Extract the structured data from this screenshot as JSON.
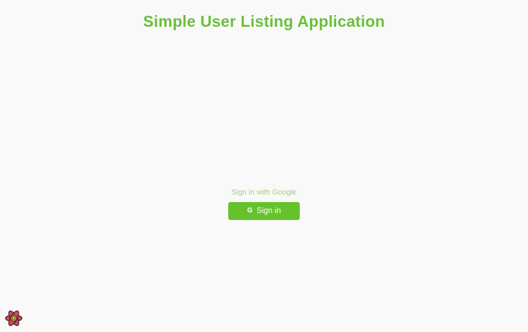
{
  "app": {
    "title": "Simple User Listing Application"
  },
  "signin": {
    "caption": "Sign in with Google",
    "button_label": "Sign in",
    "button_icon": "google-g-icon",
    "button_icon_glyph": "G"
  },
  "devtools": {
    "icon": "react-devtools-icon"
  },
  "colors": {
    "background": "#f9f9f9",
    "accent": "#6cbf3b",
    "button": "#66c22a",
    "caption": "#9bd27c"
  }
}
